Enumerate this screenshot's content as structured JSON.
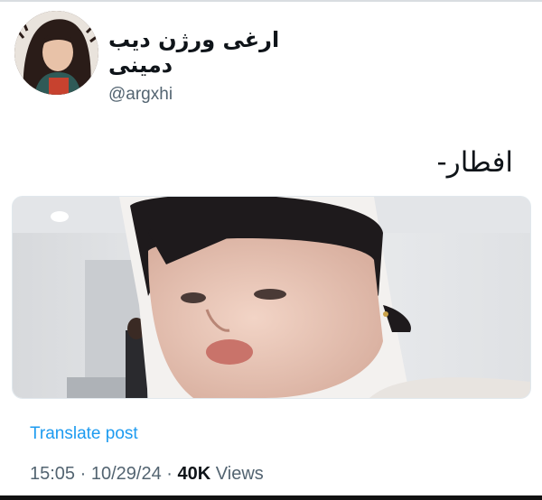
{
  "tweet": {
    "display_name": "ارغی ورژن دیب دمینی",
    "handle": "@argxhi",
    "text": "افطار-",
    "translate_label": "Translate post",
    "time": "15:05",
    "date": "10/29/24",
    "separator": "·",
    "views_count": "40K",
    "views_label": "Views"
  },
  "media": {
    "alt": "photo"
  },
  "colors": {
    "link": "#1d9bf0",
    "muted": "#536471",
    "text": "#0f1419"
  }
}
